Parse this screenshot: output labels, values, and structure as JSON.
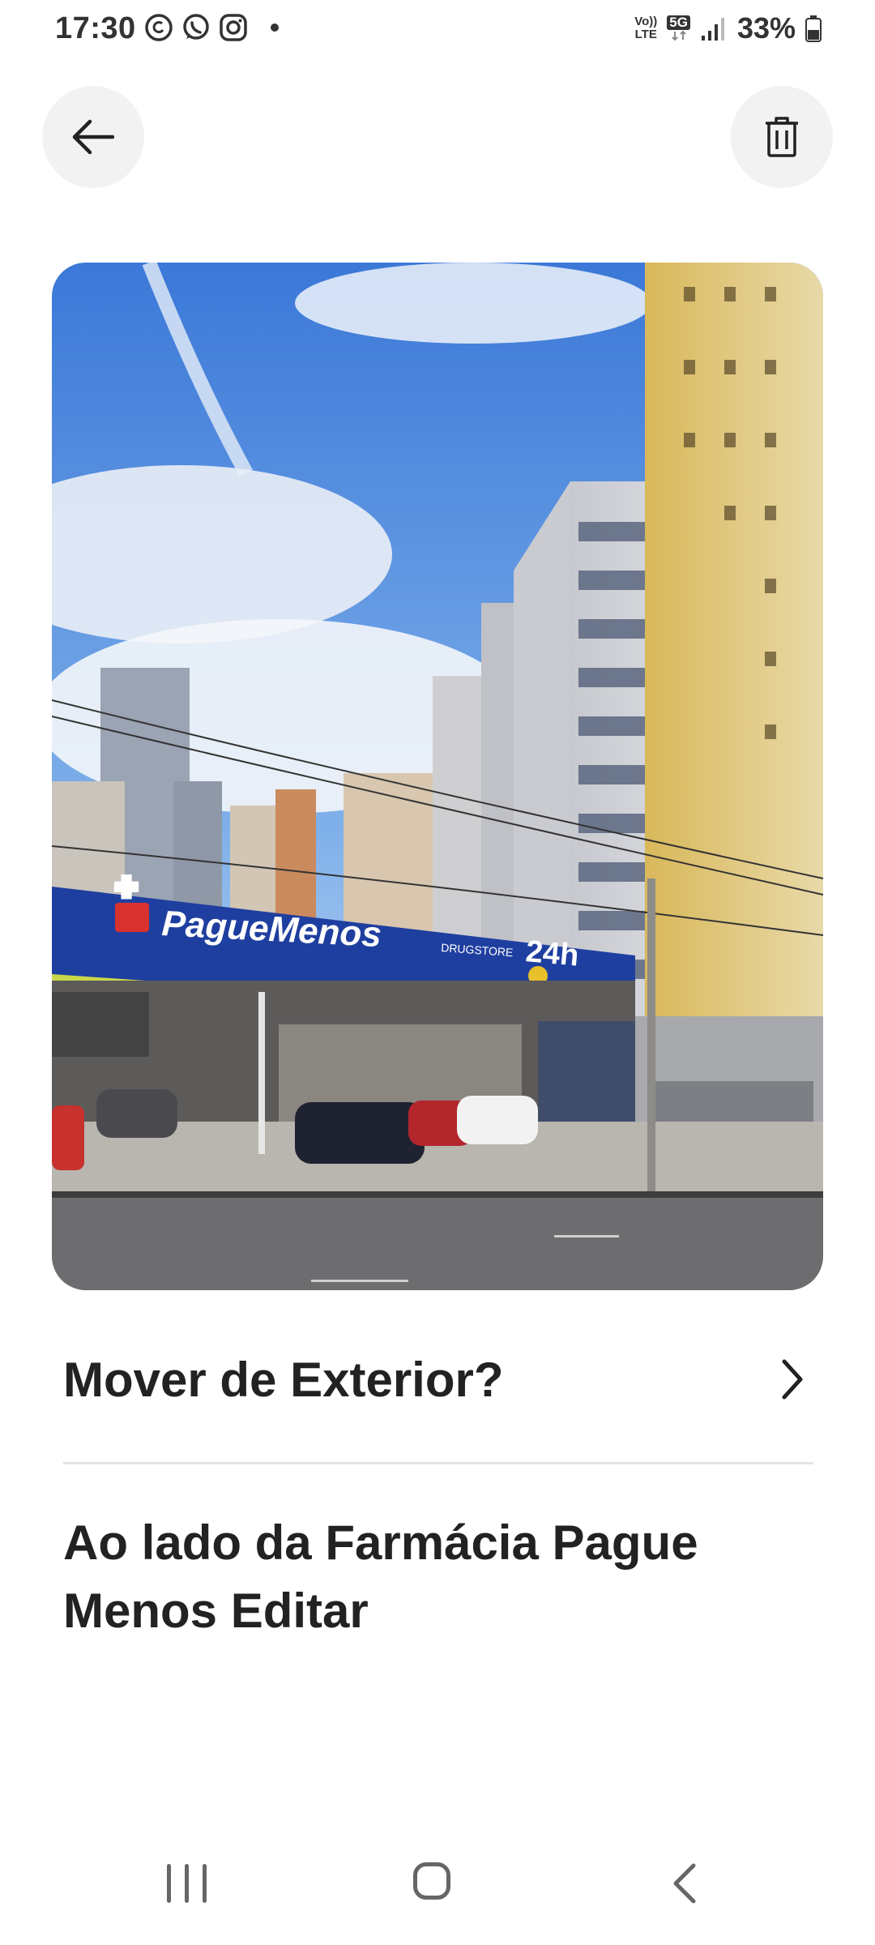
{
  "status_bar": {
    "time": "17:30",
    "apps": [
      "threads-icon",
      "whatsapp-icon",
      "instagram-icon"
    ],
    "network_top": "Vo))",
    "network_bottom": "LTE",
    "network_type": "5G",
    "battery": "33%"
  },
  "toolbar": {
    "back_icon": "arrow-left-icon",
    "delete_icon": "trash-icon"
  },
  "photo": {
    "storefront_name": "PagueMenos",
    "storefront_sub": "DRUGSTORE",
    "storefront_badge": "24h"
  },
  "move_row": {
    "label": "Mover de Exterior?"
  },
  "description": {
    "text": "Ao lado da Farmácia Pague Menos Editar"
  },
  "colors": {
    "text": "#222222",
    "button_bg": "#f2f2f2",
    "divider": "#e4e4e4",
    "store_blue": "#1f3fa0"
  }
}
